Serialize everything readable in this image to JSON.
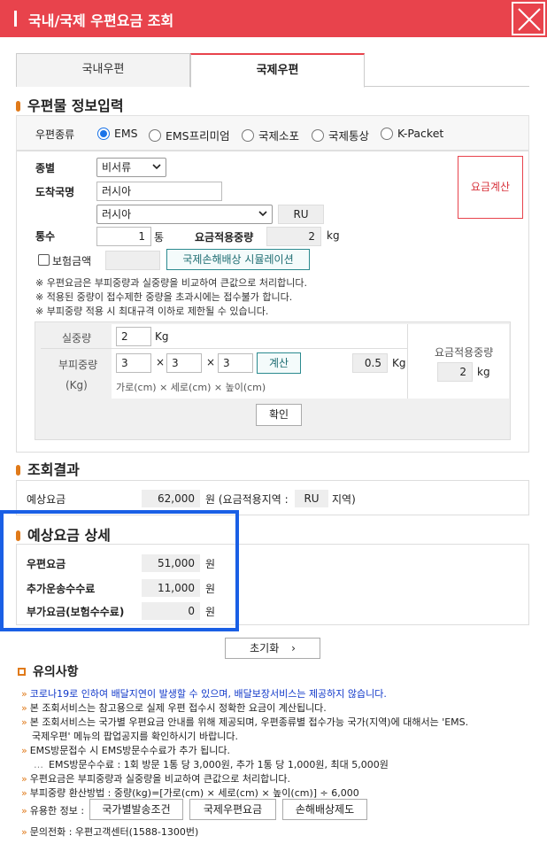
{
  "window": {
    "title": "국내/국제 우편요금 조회"
  },
  "tabs": {
    "domestic": "국내우편",
    "international": "국제우편"
  },
  "info_section": {
    "title": "우편물 정보입력",
    "mail_type_label": "우편종류",
    "mail_types": [
      "EMS",
      "EMS프리미엄",
      "국제소포",
      "국제통상",
      "K-Packet"
    ],
    "selected_mail_type": "EMS",
    "category_label": "종별",
    "category_value": "비서류",
    "destination_label": "도착국명",
    "destination_input": "러시아",
    "destination_select": "러시아",
    "country_code": "RU",
    "count_label": "통수",
    "count_value": "1",
    "count_unit": "통",
    "applied_weight_label": "요금적용중량",
    "applied_weight_value": "2",
    "weight_unit": "kg",
    "insurance_label": "보험금액",
    "simulation_button": "국제손해배상 시뮬레이션",
    "calc_button": "요금계산",
    "notes": [
      "우편요금은 부피중량과 실중량을 비교하여 큰값으로 처리합니다.",
      "적용된 중량이 접수제한 중량을 초과시에는 접수불가 합니다.",
      "부피중량 적용 시 최대규격 이하로 제한될 수 있습니다."
    ],
    "note_mark": "※",
    "actual_weight_label": "실중량",
    "actual_weight_value": "2",
    "actual_weight_unit": "Kg",
    "volume_weight_label": "부피중량",
    "volume_weight_unit_label": "(Kg)",
    "dim_width": "3",
    "dim_depth": "3",
    "dim_height": "3",
    "times": "×",
    "dim_calc_button": "계산",
    "volume_weight_value": "0.5",
    "volume_weight_unit": "Kg",
    "dim_caption": "가로(cm) × 세로(cm) × 높이(cm)",
    "side_applied_label": "요금적용중량",
    "side_applied_value": "2",
    "side_applied_unit": "kg",
    "confirm_button": "확인"
  },
  "result_section": {
    "title": "조회결과",
    "expected_fee_label": "예상요금",
    "expected_fee_value": "62,000",
    "won_prefix": "원 (요금적용지역 :",
    "zone_value": "RU",
    "zone_suffix": "지역)"
  },
  "detail_section": {
    "title": "예상요금 상세",
    "rows": [
      {
        "label": "우편요금",
        "value": "51,000",
        "unit": "원"
      },
      {
        "label": "추가운송수수료",
        "value": "11,000",
        "unit": "원"
      },
      {
        "label": "부가요금(보험수수료)",
        "value": "0",
        "unit": "원"
      }
    ]
  },
  "reset_button": "초기화",
  "caution": {
    "title": "유의사항",
    "items": [
      "코로나19로 인하여 배달지연이 발생할 수 있으며, 배달보장서비스는 제공하지 않습니다.",
      "본 조회서비스는 참고용으로 실제 우편 접수시 정확한 요금이 계산됩니다.",
      "본 조회서비스는 국가별 우편요금 안내를 위해 제공되며, 우편종류별 접수가능 국가(지역)에 대해서는 'EMS.",
      "국제우편' 메뉴의 팝업공지를 확인하시기 바랍니다.",
      "EMS방문접수 시 EMS방문수수료가 추가 됩니다.",
      "EMS방문수수료 : 1회 방문 1통 당 3,000원, 추가 1통 당 1,000원, 최대 5,000원",
      "우편요금은 부피중량과 실중량을 비교하여 큰값으로 처리합니다.",
      "부피중량 환산방법 : 중량(kg)=[가로(cm) × 세로(cm) × 높이(cm)] ÷ 6,000",
      "유용한 정보 :",
      "문의전화 : 우편고객센터(1588-1300번)"
    ],
    "useful_buttons": [
      "국가별발송조건",
      "국제우편요금",
      "손해배상제도"
    ]
  },
  "colors": {
    "accent": "#e8434c",
    "highlight": "#1a5fe5",
    "bullet": "#e07a1a",
    "radio": "#1a73e8"
  }
}
